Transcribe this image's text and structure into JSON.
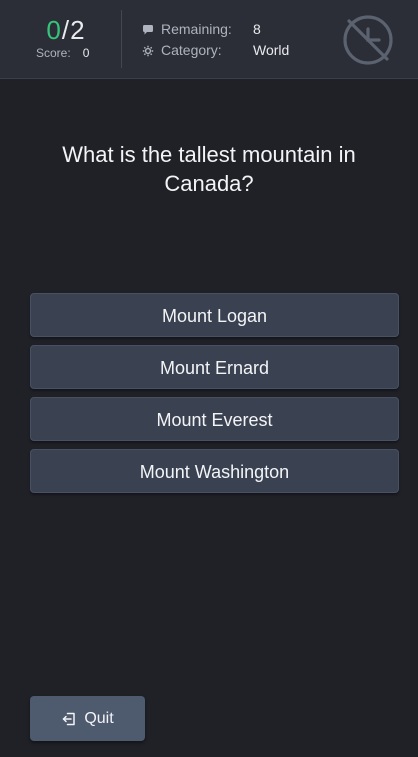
{
  "header": {
    "score": {
      "current": "0",
      "separator": "/",
      "total": "2",
      "label": "Score:",
      "value": "0"
    },
    "remaining": {
      "icon": "chat-bubble-icon",
      "label": "Remaining:",
      "value": "8"
    },
    "category": {
      "icon": "gear-icon",
      "label": "Category:",
      "value": "World"
    },
    "timer_icon": "timer-off-icon"
  },
  "question": {
    "text": "What is the tallest mountain in Canada?"
  },
  "answers": [
    {
      "label": "Mount Logan"
    },
    {
      "label": "Mount Ernard"
    },
    {
      "label": "Mount Everest"
    },
    {
      "label": "Mount Washington"
    }
  ],
  "quit": {
    "icon": "exit-icon",
    "label": "Quit"
  },
  "colors": {
    "background": "#1f2127",
    "header": "#2b2e36",
    "answer_button": "#3a4252",
    "quit_button": "#4e5a6e",
    "score_accent": "#35c47a"
  }
}
